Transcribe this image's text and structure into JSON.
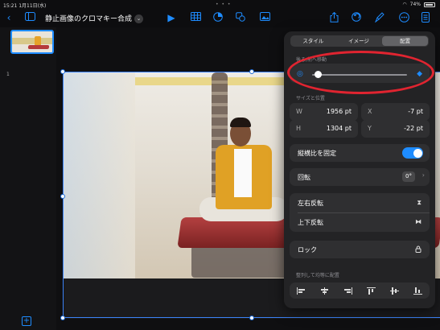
{
  "status_bar": {
    "time": "15:21",
    "date": "1月11日(水)",
    "battery": "74%"
  },
  "toolbar": {
    "document_title": "静止画像のクロマキー合成",
    "icons": [
      "back-chevron-icon",
      "sidebar-icon",
      "play-icon",
      "table-icon",
      "chart-icon",
      "shape-icon",
      "media-icon",
      "share-icon",
      "undo-icon",
      "format-brush-icon",
      "more-icon",
      "document-icon"
    ]
  },
  "sidebar": {
    "slide_number": "1"
  },
  "popover": {
    "tabs": [
      "スタイル",
      "イメージ",
      "配置"
    ],
    "active_tab": 2,
    "layer_section_label": "後ろ/前へ移動",
    "layer_slider_value": 0.03,
    "size_position_label": "サイズと位置",
    "fields": [
      {
        "label": "W",
        "value": "1956 pt"
      },
      {
        "label": "X",
        "value": "-7 pt"
      },
      {
        "label": "H",
        "value": "1304 pt"
      },
      {
        "label": "Y",
        "value": "-22 pt"
      }
    ],
    "lock_aspect_label": "縦横比を固定",
    "lock_aspect_on": true,
    "rotate_label": "回転",
    "rotate_value": "0°",
    "flip_h_label": "左右反転",
    "flip_v_label": "上下反転",
    "lock_label": "ロック",
    "align_label": "整列して均等に配置"
  },
  "colors": {
    "accent": "#1e8cff",
    "annotation": "#e02430"
  }
}
